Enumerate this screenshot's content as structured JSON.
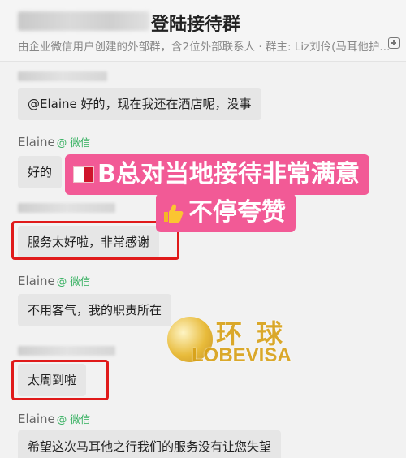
{
  "header": {
    "title": "登陆接待群",
    "subtitle": "由企业微信用户创建的外部群，含2位外部联系人 · 群主: Liz刘伶(马耳他护..."
  },
  "messages": [
    {
      "sender": "",
      "text": "@Elaine  好的，现在我还在酒店呢，没事"
    },
    {
      "sender": "Elaine",
      "via": "@ 微信",
      "text": "好的"
    },
    {
      "sender": "",
      "text": "服务太好啦，非常感谢"
    },
    {
      "sender": "Elaine",
      "via": "@ 微信",
      "text": "不用客气，我的职责所在"
    },
    {
      "sender": "",
      "text": "太周到啦"
    },
    {
      "sender": "Elaine",
      "via": "@ 微信",
      "text": "希望这次马耳他之行我们的服务没有让您失望"
    }
  ],
  "overlay": {
    "line1": "B总对当地接待非常满意",
    "line2": "不停夸赞"
  },
  "watermark": {
    "cn": "环球",
    "en": "LOBEVISA"
  },
  "colors": {
    "banner": "#f25a96",
    "highlight": "#e01a1a",
    "wechat_green": "#2fae5b",
    "watermark_gold": "#d8a21a"
  }
}
